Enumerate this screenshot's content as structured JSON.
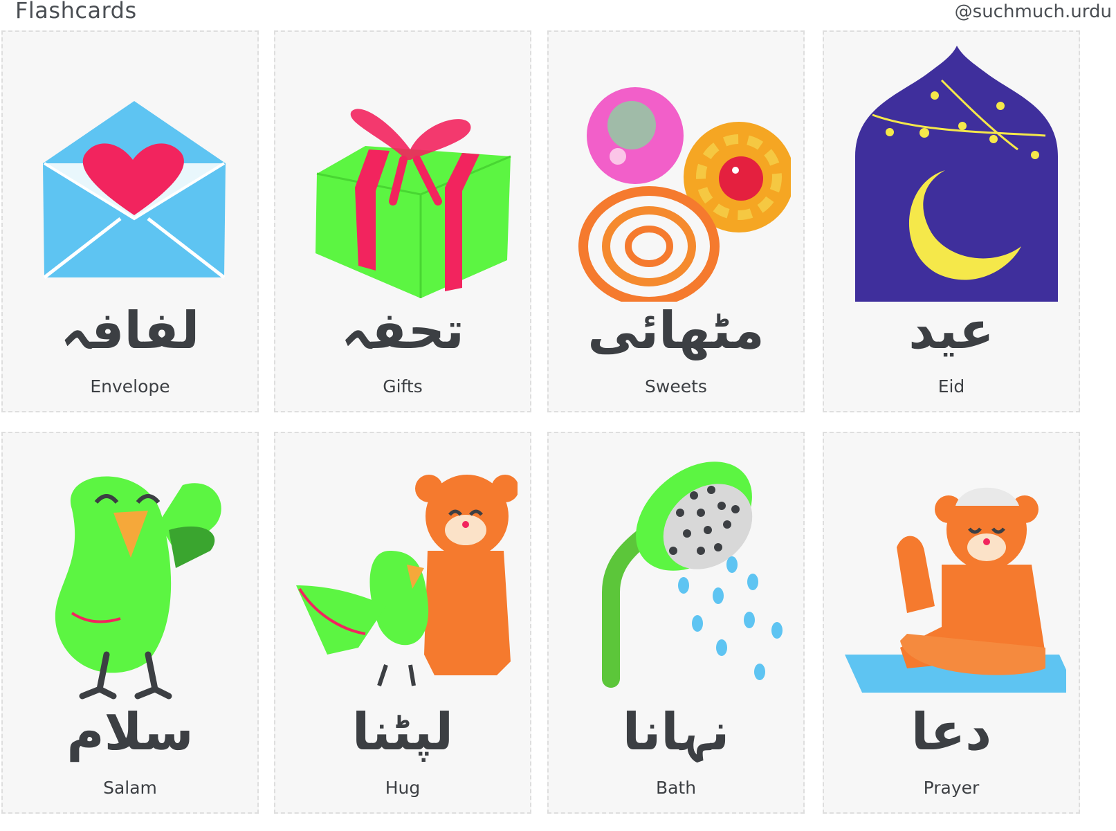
{
  "header": {
    "title": "Flashcards",
    "handle": "@suchmuch.urdu"
  },
  "cards": [
    {
      "urdu": "لفافہ",
      "english": "Envelope",
      "icon": "envelope-heart-icon"
    },
    {
      "urdu": "تحفہ",
      "english": "Gifts",
      "icon": "gift-box-icon"
    },
    {
      "urdu": "مٹھائی",
      "english": "Sweets",
      "icon": "sweets-icon"
    },
    {
      "urdu": "عید",
      "english": "Eid",
      "icon": "crescent-moon-icon"
    },
    {
      "urdu": "سلام",
      "english": "Salam",
      "icon": "parrot-waving-icon"
    },
    {
      "urdu": "لپٹنا",
      "english": "Hug",
      "icon": "bear-parrot-hug-icon"
    },
    {
      "urdu": "نہانا",
      "english": "Bath",
      "icon": "shower-head-icon"
    },
    {
      "urdu": "دعا",
      "english": "Prayer",
      "icon": "praying-bear-icon"
    }
  ],
  "colors": {
    "card_bg": "#f7f7f7",
    "text": "#3c3f43",
    "green": "#5cf542",
    "orange": "#f57a2e",
    "blue": "#5ec4f2",
    "pink": "#f2245e",
    "purple": "#3f2f9c",
    "yellow": "#f5e84a"
  }
}
